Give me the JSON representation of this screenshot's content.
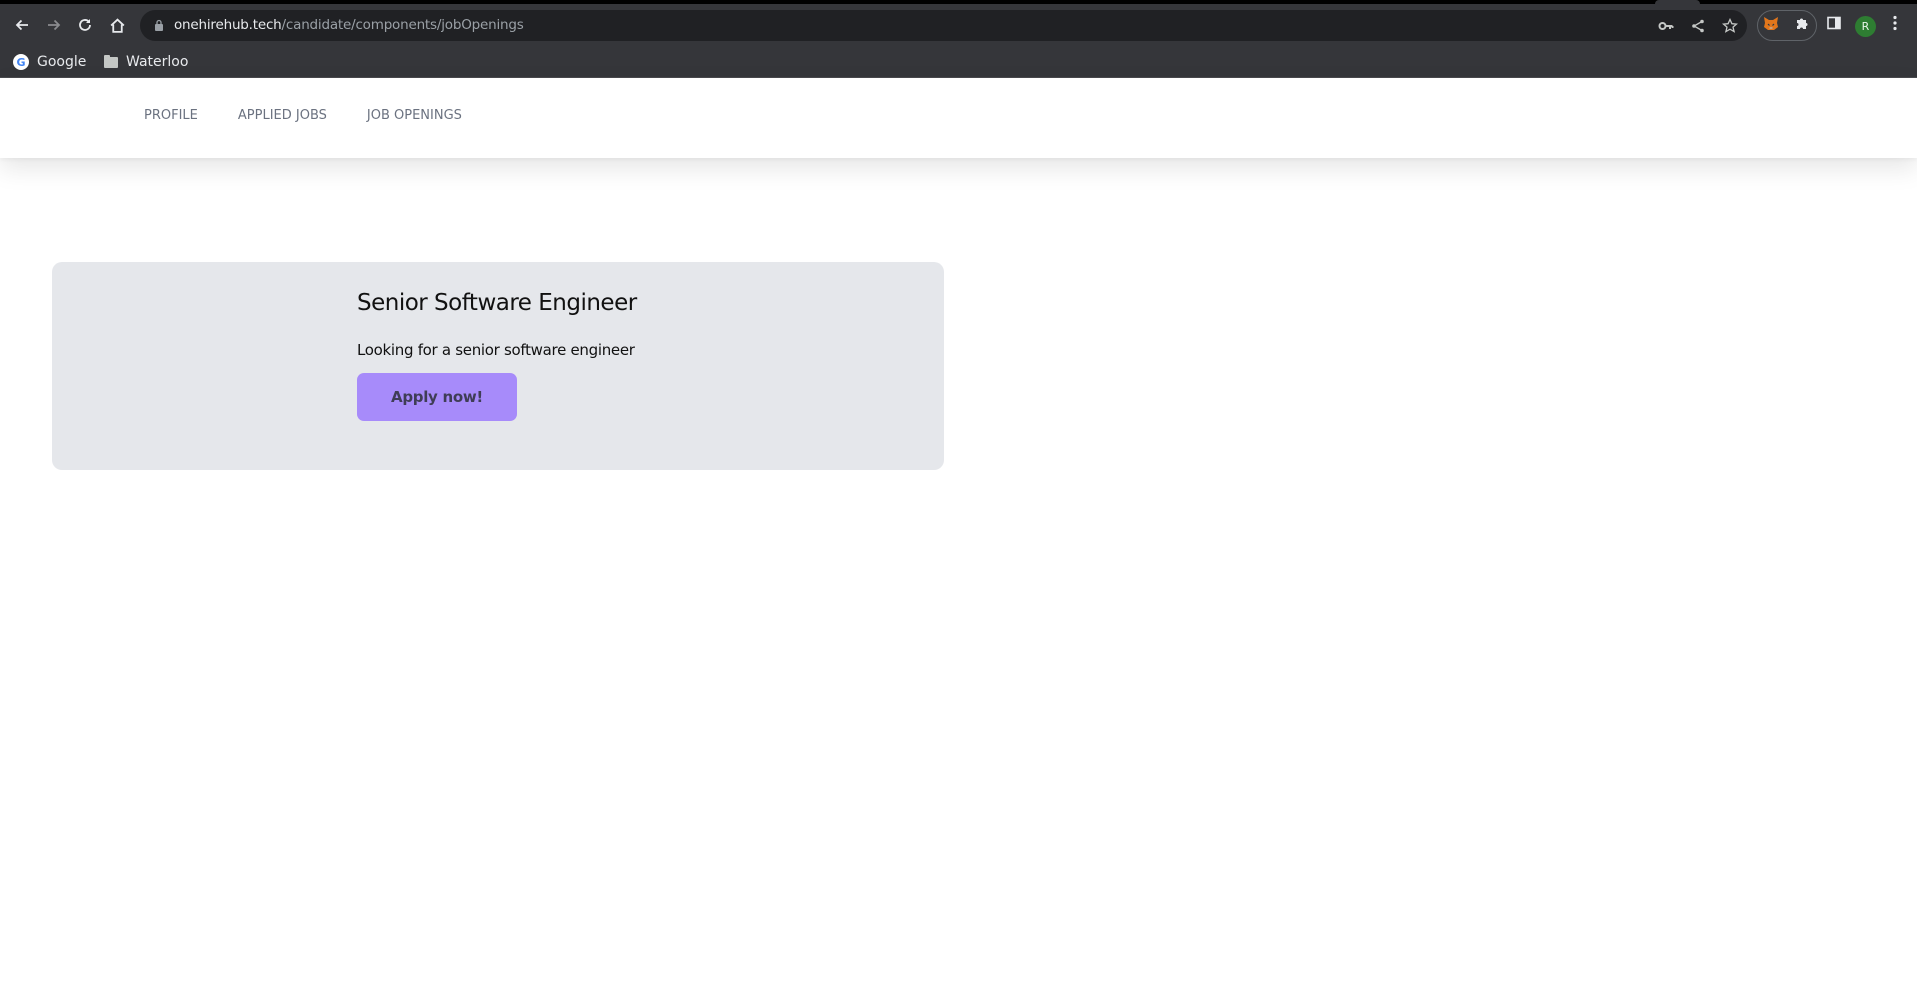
{
  "browser": {
    "url_host": "onehirehub.tech",
    "url_path": "/candidate/components/jobOpenings",
    "bookmarks": [
      {
        "label": "Google",
        "icon": "google-icon"
      },
      {
        "label": "Waterloo",
        "icon": "folder-icon"
      }
    ],
    "avatar_initial": "R",
    "colors": {
      "avatar": "#2e7d32",
      "toolbar": "#35363a",
      "omnibox": "#202124"
    }
  },
  "header": {
    "nav": [
      {
        "label": "PROFILE"
      },
      {
        "label": "APPLIED JOBS"
      },
      {
        "label": "JOB OPENINGS"
      }
    ]
  },
  "jobs": [
    {
      "title": "Senior Software Engineer",
      "description": "Looking for a senior software engineer",
      "apply_label": "Apply now!"
    }
  ],
  "theme": {
    "card_bg": "#e5e7eb",
    "accent": "#a78bfa",
    "nav_text": "#6b7280"
  }
}
